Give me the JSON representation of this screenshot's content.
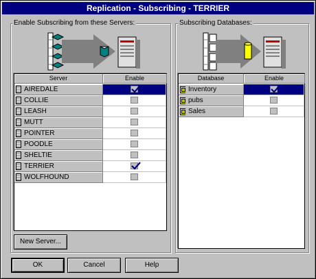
{
  "window": {
    "title": "Replication - Subscribing - TERRIER"
  },
  "left_group": {
    "label": "Enable Subscribing from these Servers:",
    "columns": [
      "Server",
      "Enable"
    ],
    "rows": [
      {
        "name": "AIREDALE",
        "enabled": true,
        "selected": true
      },
      {
        "name": "COLLIE",
        "enabled": false,
        "selected": false
      },
      {
        "name": "LEASH",
        "enabled": false,
        "selected": false
      },
      {
        "name": "MUTT",
        "enabled": false,
        "selected": false
      },
      {
        "name": "POINTER",
        "enabled": false,
        "selected": false
      },
      {
        "name": "POODLE",
        "enabled": false,
        "selected": false
      },
      {
        "name": "SHELTIE",
        "enabled": false,
        "selected": false
      },
      {
        "name": "TERRIER",
        "enabled": true,
        "selected": false
      },
      {
        "name": "WOLFHOUND",
        "enabled": false,
        "selected": false
      }
    ],
    "new_server_label": "New Server..."
  },
  "right_group": {
    "label": "Subscribing Databases:",
    "columns": [
      "Database",
      "Enable"
    ],
    "rows": [
      {
        "name": "Inventory",
        "enabled": true,
        "selected": true
      },
      {
        "name": "pubs",
        "enabled": false,
        "selected": false
      },
      {
        "name": "Sales",
        "enabled": false,
        "selected": false
      }
    ]
  },
  "buttons": {
    "ok": "OK",
    "cancel": "Cancel",
    "help": "Help"
  },
  "colors": {
    "title_bar": "#000080",
    "face": "#c0c0c0",
    "selection": "#000080",
    "check": "#000080",
    "arrow": "#808080",
    "server_teal": "#008080",
    "db_yellow": "#ffff00"
  }
}
